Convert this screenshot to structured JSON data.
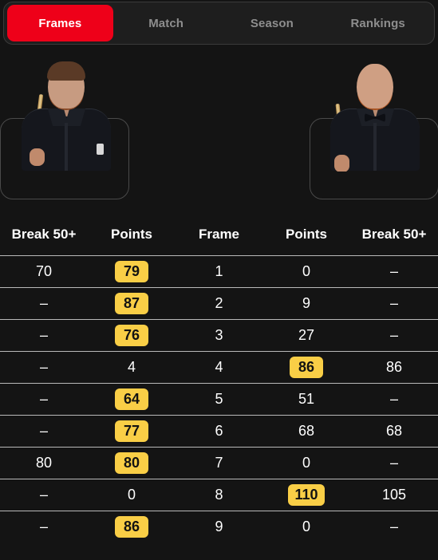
{
  "theme": {
    "background": "#141414",
    "accent_red": "#ee0019",
    "badge_yellow": "#f9ce46",
    "text_primary": "#ffffff",
    "text_muted": "#8e8e8e",
    "divider": "#b9b9b9"
  },
  "tabs": [
    {
      "label": "Frames",
      "active": true
    },
    {
      "label": "Match",
      "active": false
    },
    {
      "label": "Season",
      "active": false
    },
    {
      "label": "Rankings",
      "active": false
    }
  ],
  "players": {
    "left": {
      "photo_alt": "left-player-portrait"
    },
    "right": {
      "photo_alt": "right-player-portrait"
    }
  },
  "table": {
    "headers": [
      "Break 50+",
      "Points",
      "Frame",
      "Points",
      "Break 50+"
    ],
    "rows": [
      {
        "break_left": "70",
        "points_left": "79",
        "points_left_highlight": true,
        "frame": "1",
        "points_right": "0",
        "points_right_highlight": false,
        "break_right": "–"
      },
      {
        "break_left": "–",
        "points_left": "87",
        "points_left_highlight": true,
        "frame": "2",
        "points_right": "9",
        "points_right_highlight": false,
        "break_right": "–"
      },
      {
        "break_left": "–",
        "points_left": "76",
        "points_left_highlight": true,
        "frame": "3",
        "points_right": "27",
        "points_right_highlight": false,
        "break_right": "–"
      },
      {
        "break_left": "–",
        "points_left": "4",
        "points_left_highlight": false,
        "frame": "4",
        "points_right": "86",
        "points_right_highlight": true,
        "break_right": "86"
      },
      {
        "break_left": "–",
        "points_left": "64",
        "points_left_highlight": true,
        "frame": "5",
        "points_right": "51",
        "points_right_highlight": false,
        "break_right": "–"
      },
      {
        "break_left": "–",
        "points_left": "77",
        "points_left_highlight": true,
        "frame": "6",
        "points_right": "68",
        "points_right_highlight": false,
        "break_right": "68"
      },
      {
        "break_left": "80",
        "points_left": "80",
        "points_left_highlight": true,
        "frame": "7",
        "points_right": "0",
        "points_right_highlight": false,
        "break_right": "–"
      },
      {
        "break_left": "–",
        "points_left": "0",
        "points_left_highlight": false,
        "frame": "8",
        "points_right": "110",
        "points_right_highlight": true,
        "break_right": "105"
      },
      {
        "break_left": "–",
        "points_left": "86",
        "points_left_highlight": true,
        "frame": "9",
        "points_right": "0",
        "points_right_highlight": false,
        "break_right": "–"
      }
    ]
  }
}
